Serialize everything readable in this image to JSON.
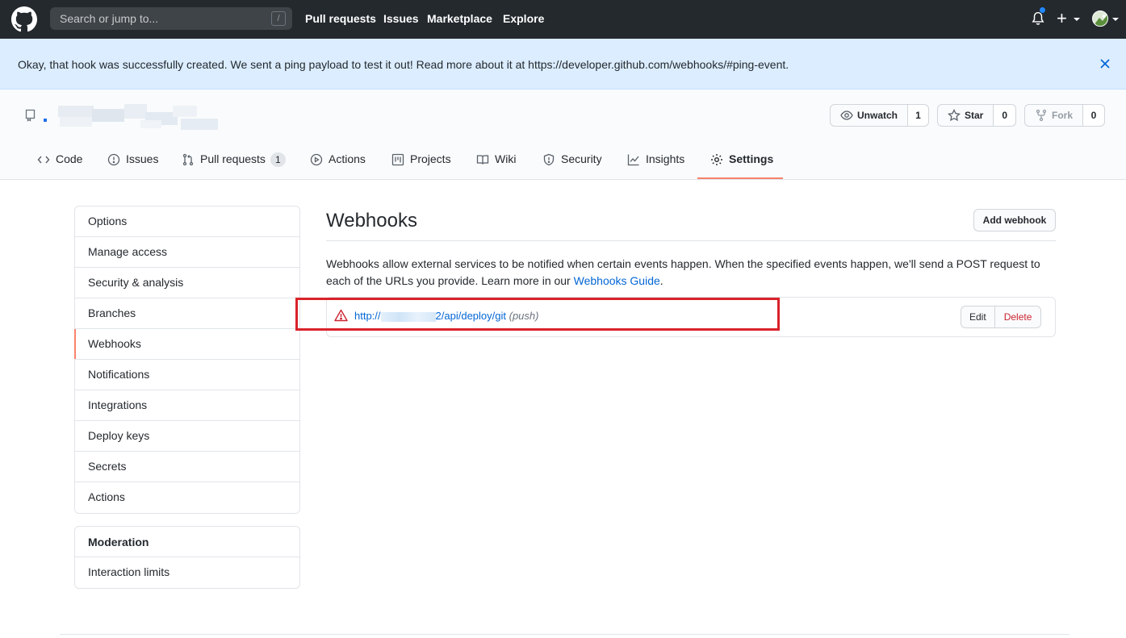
{
  "header": {
    "search_placeholder": "Search or jump to...",
    "search_key": "/",
    "nav": [
      "Pull requests",
      "Issues",
      "Marketplace",
      "Explore"
    ],
    "plus_label": "+"
  },
  "flash": {
    "message": "Okay, that hook was successfully created. We sent a ping payload to test it out! Read more about it at https://developer.github.com/webhooks/#ping-event."
  },
  "repo": {
    "watch_label": "Unwatch",
    "watch_count": "1",
    "star_label": "Star",
    "star_count": "0",
    "fork_label": "Fork",
    "fork_count": "0"
  },
  "tabs": [
    {
      "label": "Code",
      "icon": "code-icon"
    },
    {
      "label": "Issues",
      "icon": "issue-icon"
    },
    {
      "label": "Pull requests",
      "icon": "pull-request-icon",
      "counter": "1"
    },
    {
      "label": "Actions",
      "icon": "play-icon"
    },
    {
      "label": "Projects",
      "icon": "project-icon"
    },
    {
      "label": "Wiki",
      "icon": "book-icon"
    },
    {
      "label": "Security",
      "icon": "shield-icon"
    },
    {
      "label": "Insights",
      "icon": "graph-icon"
    },
    {
      "label": "Settings",
      "icon": "gear-icon",
      "selected": true
    }
  ],
  "sidebar": {
    "items": [
      "Options",
      "Manage access",
      "Security & analysis",
      "Branches",
      "Webhooks",
      "Notifications",
      "Integrations",
      "Deploy keys",
      "Secrets",
      "Actions"
    ],
    "selected": "Webhooks",
    "moderation_heading": "Moderation",
    "moderation_items": [
      "Interaction limits"
    ]
  },
  "main": {
    "title": "Webhooks",
    "add_button": "Add webhook",
    "description": "Webhooks allow external services to be notified when certain events happen. When the specified events happen, we'll send a POST request to each of the URLs you provide. Learn more in our ",
    "guide_link": "Webhooks Guide",
    "description_end": ".",
    "hook": {
      "url_prefix": "http://",
      "url_suffix": "2/api/deploy/git",
      "events": "(push)",
      "edit_label": "Edit",
      "delete_label": "Delete"
    }
  },
  "colors": {
    "header_bg": "#24292e",
    "flash_bg": "#dbedff",
    "link": "#0366d6",
    "danger": "#cb2431",
    "tab_underline": "#f9826c",
    "highlight": "#d9222a"
  }
}
